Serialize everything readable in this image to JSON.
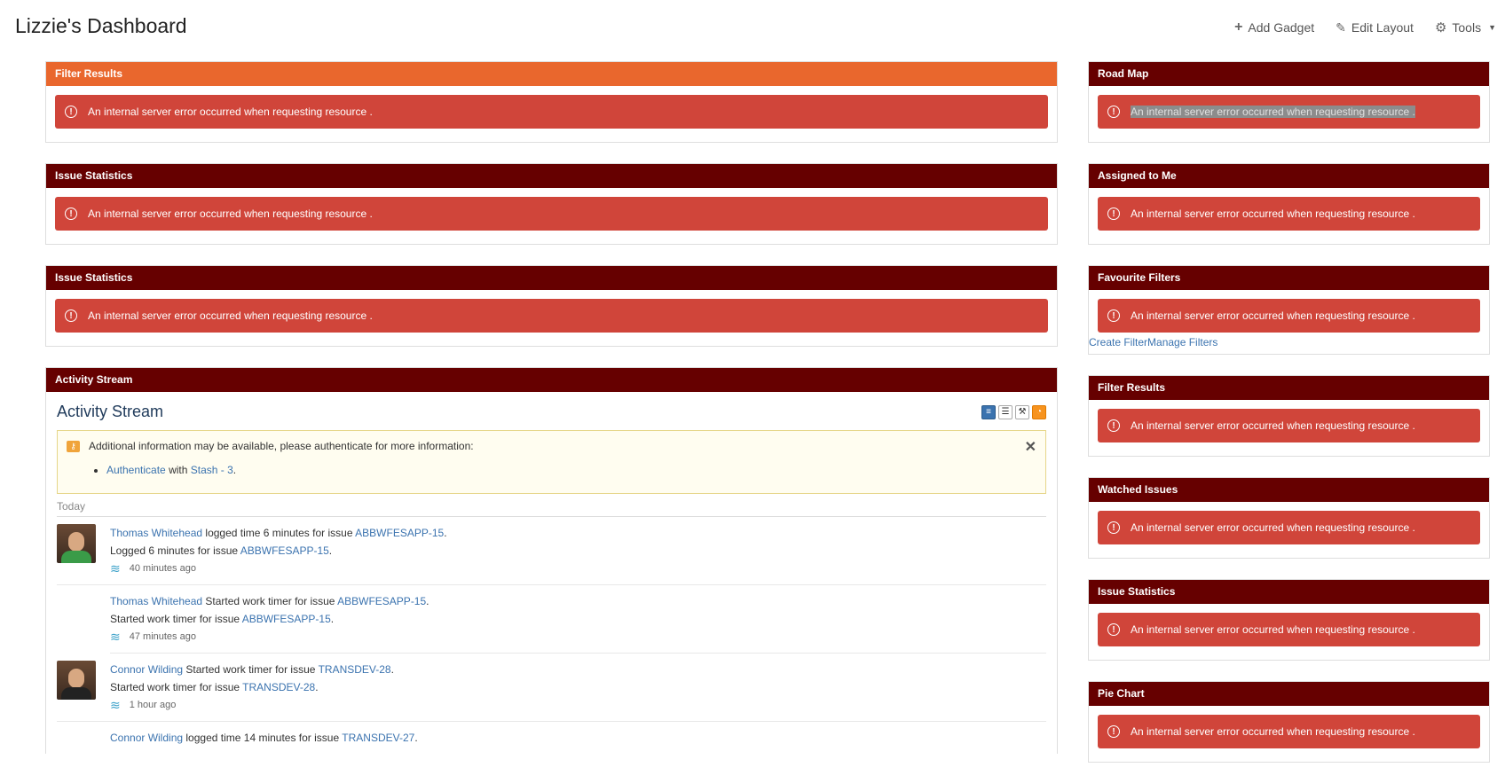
{
  "page": {
    "title": "Lizzie's Dashboard"
  },
  "toolbar": {
    "add_gadget": "Add Gadget",
    "edit_layout": "Edit Layout",
    "tools": "Tools"
  },
  "error_message": "An internal server error occurred when requesting resource .",
  "left_gadgets": [
    {
      "title": "Filter Results",
      "style": "orange"
    },
    {
      "title": "Issue Statistics"
    },
    {
      "title": "Issue Statistics"
    }
  ],
  "right_gadgets": [
    {
      "title": "Road Map",
      "selected": true
    },
    {
      "title": "Assigned to Me"
    },
    {
      "title": "Favourite Filters",
      "links": "Create FilterManage Filters"
    },
    {
      "title": "Filter Results"
    },
    {
      "title": "Watched Issues"
    },
    {
      "title": "Issue Statistics"
    },
    {
      "title": "Pie Chart"
    }
  ],
  "activity_stream": {
    "gadget_title": "Activity Stream",
    "title": "Activity Stream",
    "auth_notice": "Additional information may be available, please authenticate for more information:",
    "auth_link": "Authenticate",
    "auth_with": "with",
    "auth_target": "Stash - 3",
    "auth_end": ".",
    "today_label": "Today",
    "entries": [
      {
        "user": "Thomas Whitehead",
        "action": "logged time 6 minutes for issue",
        "issue": "ABBWFESAPP-15",
        "detail": "Logged 6 minutes for issue",
        "time": "40 minutes ago"
      },
      {
        "user": "Thomas Whitehead",
        "action": "Started work timer for issue",
        "issue": "ABBWFESAPP-15",
        "detail": "Started work timer for issue",
        "time": "47 minutes ago"
      },
      {
        "user": "Connor Wilding",
        "action": "Started work timer for issue",
        "issue": "TRANSDEV-28",
        "detail": "Started work timer for issue",
        "time": "1 hour ago"
      },
      {
        "user": "Connor Wilding",
        "action": "logged time 14 minutes for issue",
        "issue": "TRANSDEV-27",
        "detail": "",
        "time": ""
      }
    ]
  },
  "colors": {
    "header_dark": "#660000",
    "header_orange": "#e9672d",
    "error_red": "#d0453a",
    "link_blue": "#3b73af"
  }
}
